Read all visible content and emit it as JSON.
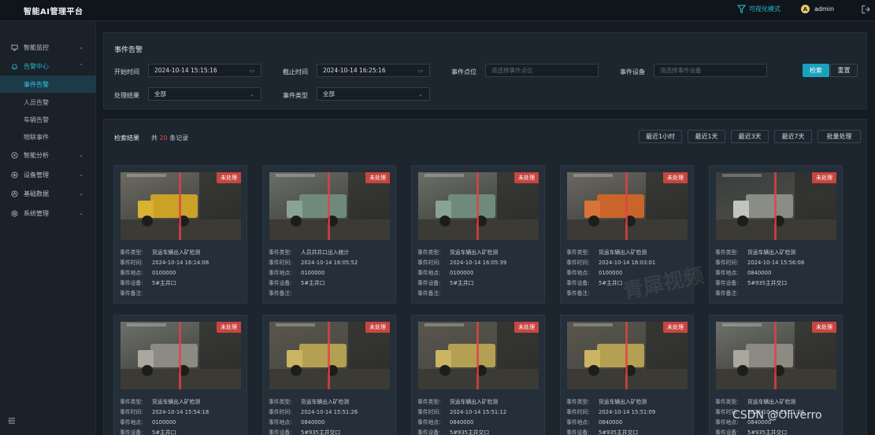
{
  "app": {
    "title": "智能AI管理平台",
    "viz_mode": "可视化模式",
    "user": "admin",
    "avatar_letter": "A"
  },
  "sidebar": {
    "items": [
      {
        "label": "智能监控",
        "icon": "monitor-icon",
        "expanded": false
      },
      {
        "label": "告警中心",
        "icon": "bell-icon",
        "expanded": true,
        "children": [
          {
            "label": "事件告警",
            "active": true
          },
          {
            "label": "人员告警",
            "active": false
          },
          {
            "label": "车辆告警",
            "active": false
          },
          {
            "label": "物联事件",
            "active": false
          }
        ]
      },
      {
        "label": "智能分析",
        "icon": "compass-icon",
        "expanded": false
      },
      {
        "label": "设备管理",
        "icon": "device-icon",
        "expanded": false
      },
      {
        "label": "基础数据",
        "icon": "data-icon",
        "expanded": false
      },
      {
        "label": "系统管理",
        "icon": "gear-icon",
        "expanded": false
      }
    ]
  },
  "filters": {
    "title": "事件告警",
    "start_label": "开始时间",
    "start_value": "2024-10-14 15:15:16",
    "end_label": "截止时间",
    "end_value": "2024-10-14 16:25:16",
    "point_label": "事件点位",
    "point_placeholder": "请选择事件点位",
    "device_label": "事件设备",
    "device_placeholder": "请选择事件设备",
    "search_btn": "检索",
    "reset_btn": "重置",
    "result_label": "处理结果",
    "result_value": "全部",
    "type_label": "事件类型",
    "type_value": "全部"
  },
  "results": {
    "heading": "检索结果",
    "count_prefix": "共",
    "count": "20",
    "count_suffix": "条记录",
    "quick": [
      "最近1小时",
      "最近1天",
      "最近3天",
      "最近7天"
    ],
    "batch": "批量处理"
  },
  "field_keys": {
    "type": "事件类型:",
    "time": "事件时间:",
    "place": "事件地点:",
    "device": "事件设备:",
    "note": "事件备注:"
  },
  "cards": [
    {
      "status": "未处理",
      "type": "货运车辆出入矿检测",
      "time": "2024-10-14 16:14:08",
      "place": "0100000",
      "device": "5#主井口",
      "note": "",
      "scene": "yellow"
    },
    {
      "status": "未处理",
      "type": "人员井井口出入统计",
      "time": "2024-10-14 16:05:52",
      "place": "0100000",
      "device": "5#主井口",
      "note": "",
      "scene": "green"
    },
    {
      "status": "未处理",
      "type": "货运车辆出入矿检测",
      "time": "2024-10-14 16:05:39",
      "place": "0100000",
      "device": "5#主井口",
      "note": "",
      "scene": "green"
    },
    {
      "status": "未处理",
      "type": "货运车辆出入矿检测",
      "time": "2024-10-14 16:03:01",
      "place": "0100000",
      "device": "5#主井口",
      "note": "",
      "scene": "orange"
    },
    {
      "status": "未处理",
      "type": "货运车辆出入矿检测",
      "time": "2024-10-14 15:56:08",
      "place": "0840000",
      "device": "5#935主井交口",
      "note": "",
      "scene": "dark"
    },
    {
      "status": "未处理",
      "type": "货运车辆出入矿检测",
      "time": "2024-10-14 15:54:18",
      "place": "0100000",
      "device": "5#主井口",
      "note": "",
      "scene": "gray"
    },
    {
      "status": "未处理",
      "type": "货运车辆出入矿检测",
      "time": "2024-10-14 15:51:26",
      "place": "0840000",
      "device": "5#935主井交口",
      "note": "",
      "scene": "night"
    },
    {
      "status": "未处理",
      "type": "货运车辆出入矿检测",
      "time": "2024-10-14 15:51:12",
      "place": "0840000",
      "device": "5#935主井交口",
      "note": "",
      "scene": "night"
    },
    {
      "status": "未处理",
      "type": "货运车辆出入矿检测",
      "time": "2024-10-14 15:51:09",
      "place": "0840000",
      "device": "5#935主井交口",
      "note": "",
      "scene": "night"
    },
    {
      "status": "未处理",
      "type": "货运车辆出入矿检测",
      "time": "2024-10-14 15:51:06",
      "place": "0840000",
      "device": "5#935主井交口",
      "note": "",
      "scene": "gray"
    }
  ],
  "watermark": "CSDN @Oliverro",
  "watermark2": "青犀视频"
}
